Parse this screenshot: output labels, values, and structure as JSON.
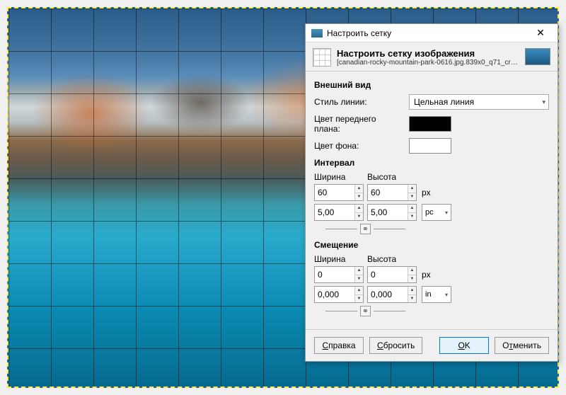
{
  "dialog": {
    "title": "Настроить сетку",
    "header_title": "Настроить сетку изображения",
    "header_sub": "[canadian-rocky-mountain-park-0616.jpg.839x0_q71_crop-scale] (и…"
  },
  "appearance": {
    "section": "Внешний вид",
    "line_style_label": "Стиль линии:",
    "line_style_value": "Цельная линия",
    "fg_label": "Цвет переднего плана:",
    "bg_label": "Цвет фона:",
    "fg_color": "#000000",
    "bg_color": "#ffffff"
  },
  "interval": {
    "section": "Интервал",
    "width_label": "Ширина",
    "height_label": "Высота",
    "width_px": "60",
    "height_px": "60",
    "unit_px": "px",
    "width_pc": "5,00",
    "height_pc": "5,00",
    "unit_pc": "pc"
  },
  "offset": {
    "section": "Смещение",
    "width_label": "Ширина",
    "height_label": "Высота",
    "width_px": "0",
    "height_px": "0",
    "unit_px": "px",
    "width_in": "0,000",
    "height_in": "0,000",
    "unit_in": "in"
  },
  "buttons": {
    "help": "Справка",
    "reset": "Сбросить",
    "ok": "OK",
    "cancel": "Отменить"
  }
}
